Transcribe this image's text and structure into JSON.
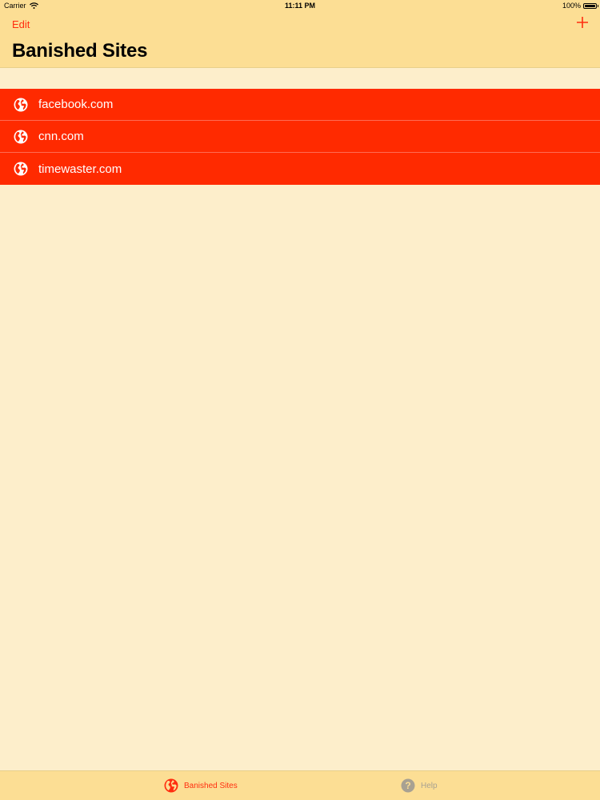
{
  "status_bar": {
    "carrier": "Carrier",
    "time": "11:11 PM",
    "battery": "100%",
    "wifi_icon": "wifi-icon",
    "battery_icon": "battery-icon"
  },
  "nav": {
    "edit_label": "Edit",
    "add_icon": "plus-icon",
    "title": "Banished Sites"
  },
  "sites": [
    {
      "label": "facebook.com",
      "icon": "globe-icon"
    },
    {
      "label": "cnn.com",
      "icon": "globe-icon"
    },
    {
      "label": "timewaster.com",
      "icon": "globe-icon"
    }
  ],
  "tabs": [
    {
      "label": "Banished Sites",
      "icon": "globe-icon",
      "selected": true
    },
    {
      "label": "Help",
      "icon": "question-icon",
      "selected": false
    }
  ],
  "colors": {
    "accent": "#FF2D0F",
    "row_background": "#FF2A00",
    "bar_background": "#FCDE94",
    "page_background": "#FDEECB",
    "inactive_tab": "#A8A192"
  }
}
